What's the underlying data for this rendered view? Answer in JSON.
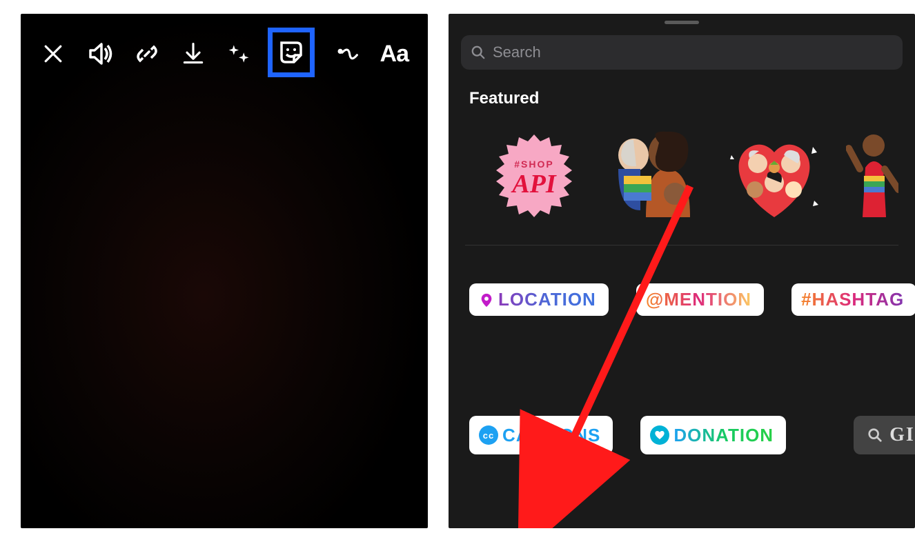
{
  "left": {
    "toolbar": {
      "close": "close-icon",
      "sound": "speaker-icon",
      "link": "link-icon",
      "download": "download-icon",
      "effects": "sparkle-icon",
      "sticker": "sticker-icon",
      "draw": "squiggle-icon",
      "text_label": "Aa"
    }
  },
  "right": {
    "search_placeholder": "Search",
    "featured_label": "Featured",
    "featured_stickers": [
      {
        "name": "shop-api-badge",
        "line1": "#SHOP",
        "line2": "API"
      },
      {
        "name": "family-illustration"
      },
      {
        "name": "heart-group-illustration"
      },
      {
        "name": "dancing-people-illustration"
      }
    ],
    "pills": {
      "location": "LOCATION",
      "mention": "@MENTION",
      "hashtag": "#HASHTAG",
      "captions_badge": "cc",
      "captions": "CAPTIONS",
      "donation": "DONATION",
      "gif": "GI"
    }
  },
  "annotation": {
    "highlight_target": "sticker-button",
    "arrow_target": "captions-sticker"
  }
}
